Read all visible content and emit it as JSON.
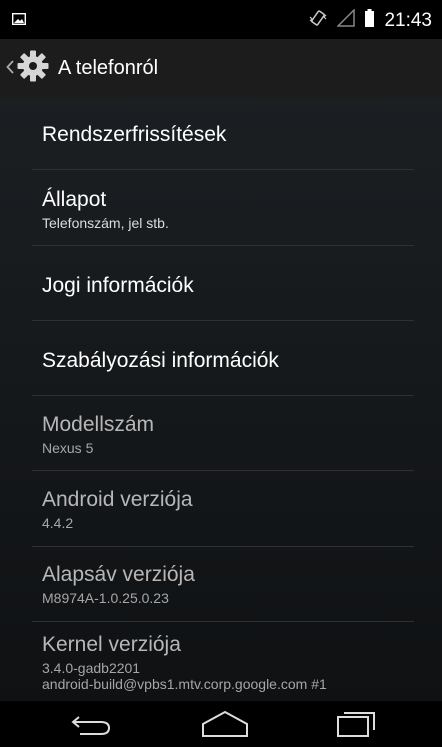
{
  "status": {
    "time": "21:43"
  },
  "header": {
    "title": "A telefonról"
  },
  "items": [
    {
      "title": "Rendszerfrissítések",
      "summary": ""
    },
    {
      "title": "Állapot",
      "summary": "Telefonszám, jel stb."
    },
    {
      "title": "Jogi információk",
      "summary": ""
    },
    {
      "title": "Szabályozási információk",
      "summary": ""
    },
    {
      "title": "Modellszám",
      "summary": "Nexus 5"
    },
    {
      "title": "Android verziója",
      "summary": "4.4.2"
    },
    {
      "title": "Alapsáv verziója",
      "summary": "M8974A-1.0.25.0.23"
    },
    {
      "title": "Kernel verziója",
      "summary": "3.4.0-gadb2201",
      "summary2": "android-build@vpbs1.mtv.corp.google.com #1"
    }
  ]
}
